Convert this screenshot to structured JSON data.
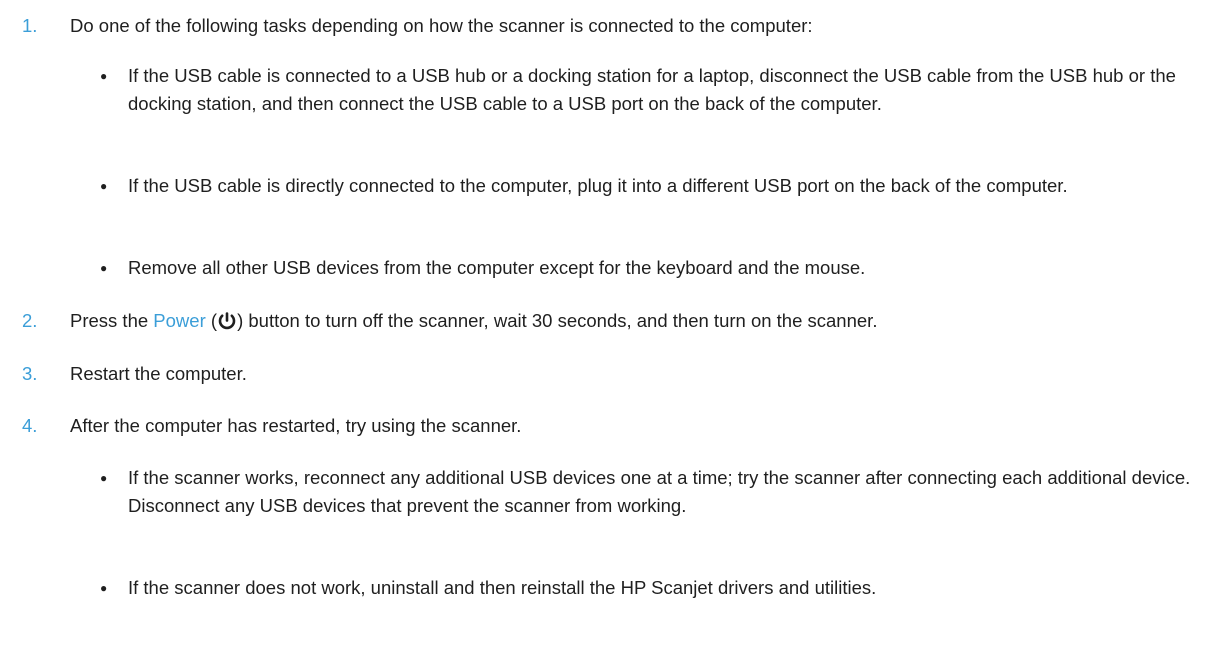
{
  "steps": [
    {
      "num": "1.",
      "text": "Do one of the following tasks depending on how the scanner is connected to the computer:",
      "bullets": [
        "If the USB cable is connected to a USB hub or a docking station for a laptop, disconnect the USB cable from the USB hub or the docking station, and then connect the USB cable to a USB port on the back of the computer.",
        "If the USB cable is directly connected to the computer, plug it into a different USB port on the back of the computer.",
        "Remove all other USB devices from the computer except for the keyboard and the mouse."
      ]
    },
    {
      "num": "2.",
      "text_before": "Press the ",
      "link": "Power",
      "text_paren_open": " (",
      "icon": "power-icon",
      "text_after": ") button to turn off the scanner, wait 30 seconds, and then turn on the scanner."
    },
    {
      "num": "3.",
      "text": "Restart the computer."
    },
    {
      "num": "4.",
      "text": "After the computer has restarted, try using the scanner.",
      "bullets": [
        "If the scanner works, reconnect any additional USB devices one at a time; try the scanner after connecting each additional device. Disconnect any USB devices that prevent the scanner from working.",
        "If the scanner does not work, uninstall and then reinstall the HP Scanjet drivers and utilities."
      ]
    }
  ],
  "bullet_glyph": "●",
  "colors": {
    "accent": "#3b9ed8",
    "text": "#1f1f1f"
  }
}
